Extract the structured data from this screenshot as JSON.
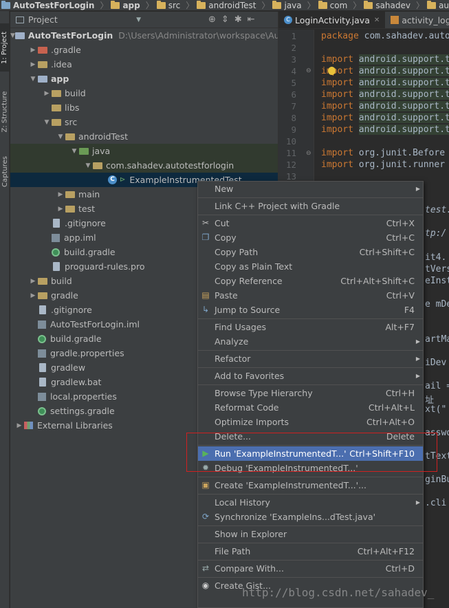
{
  "breadcrumb": [
    "AutoTestForLogin",
    "app",
    "src",
    "androidTest",
    "java",
    "com",
    "sahadev",
    "autotestforlogin"
  ],
  "toolstrip": {
    "project": "1: Project",
    "structure": "Z: Structure",
    "captures": "Captures"
  },
  "project_panel": {
    "title": "Project"
  },
  "tree": [
    {
      "label": "AutoTestForLogin",
      "path": "D:\\Users\\Administrator\\workspace\\AutoTestForLogin",
      "icon": "module-icon"
    },
    {
      "label": ".gradle",
      "icon": "folder-icon"
    },
    {
      "label": ".idea",
      "icon": "folder-icon"
    },
    {
      "label": "app",
      "icon": "module-folder-icon"
    },
    {
      "label": "build",
      "icon": "folder-icon"
    },
    {
      "label": "libs",
      "icon": "folder-icon"
    },
    {
      "label": "src",
      "icon": "folder-icon"
    },
    {
      "label": "androidTest",
      "icon": "folder-icon"
    },
    {
      "label": "java",
      "icon": "test-source-folder-icon"
    },
    {
      "label": "com.sahadev.autotestforlogin",
      "icon": "package-icon"
    },
    {
      "label": "ExampleInstrumentedTest",
      "icon": "class-icon"
    },
    {
      "label": "main",
      "icon": "folder-icon"
    },
    {
      "label": "test",
      "icon": "folder-icon"
    },
    {
      "label": ".gitignore",
      "icon": "file-icon"
    },
    {
      "label": "app.iml",
      "icon": "iml-file-icon"
    },
    {
      "label": "build.gradle",
      "icon": "gradle-icon"
    },
    {
      "label": "proguard-rules.pro",
      "icon": "file-icon"
    },
    {
      "label": "build",
      "icon": "folder-icon"
    },
    {
      "label": "gradle",
      "icon": "folder-icon"
    },
    {
      "label": ".gitignore",
      "icon": "file-icon"
    },
    {
      "label": "AutoTestForLogin.iml",
      "icon": "iml-file-icon"
    },
    {
      "label": "build.gradle",
      "icon": "gradle-icon"
    },
    {
      "label": "gradle.properties",
      "icon": "properties-file-icon"
    },
    {
      "label": "gradlew",
      "icon": "file-icon"
    },
    {
      "label": "gradlew.bat",
      "icon": "file-icon"
    },
    {
      "label": "local.properties",
      "icon": "properties-file-icon"
    },
    {
      "label": "settings.gradle",
      "icon": "gradle-icon"
    },
    {
      "label": "External Libraries",
      "icon": "libraries-icon"
    }
  ],
  "editor": {
    "tabs": [
      {
        "label": "LoginActivity.java"
      },
      {
        "label": "activity_login"
      }
    ],
    "line_numbers": [
      "1",
      "2",
      "3",
      "4",
      "5",
      "6",
      "7",
      "8",
      "9",
      "10",
      "11",
      "12",
      "13"
    ],
    "lines": {
      "l1": {
        "kw": "package",
        "rest": " com.sahadev.auto"
      },
      "l3": {
        "kw": "import",
        "rest": "android.support.t"
      },
      "l4": {
        "kw": "import",
        "rest": "android.support.t"
      },
      "l5": {
        "kw": "import",
        "rest": "android.support.t"
      },
      "l6": {
        "kw": "import",
        "rest": "android.support.t"
      },
      "l7": {
        "kw": "import",
        "rest": "android.support.t"
      },
      "l8": {
        "kw": "import",
        "rest": "android.support.t"
      },
      "l9": {
        "kw": "import",
        "rest": "android.support.t"
      },
      "l11": {
        "kw": "import",
        "rest": "org.junit.Before"
      },
      "l12": {
        "kw": "import",
        "rest": "org.junit.runner"
      }
    },
    "fragments": [
      "test.",
      "tp:/",
      "it4.",
      "tVers",
      "eInst",
      "e mDe",
      "artMa",
      "iDev",
      "ail =",
      "址",
      "xt(\"",
      "asswo",
      "tText",
      "ginBu",
      ".cli"
    ]
  },
  "context_menu": {
    "items": [
      {
        "label": "New",
        "shortcut": "",
        "submenu": true
      },
      {
        "label": "Link C++ Project with Gradle",
        "shortcut": ""
      },
      {
        "label": "Cut",
        "shortcut": "Ctrl+X"
      },
      {
        "label": "Copy",
        "shortcut": "Ctrl+C"
      },
      {
        "label": "Copy Path",
        "shortcut": "Ctrl+Shift+C"
      },
      {
        "label": "Copy as Plain Text",
        "shortcut": ""
      },
      {
        "label": "Copy Reference",
        "shortcut": "Ctrl+Alt+Shift+C"
      },
      {
        "label": "Paste",
        "shortcut": "Ctrl+V"
      },
      {
        "label": "Jump to Source",
        "shortcut": "F4"
      },
      {
        "label": "Find Usages",
        "shortcut": "Alt+F7"
      },
      {
        "label": "Analyze",
        "shortcut": "",
        "submenu": true
      },
      {
        "label": "Refactor",
        "shortcut": "",
        "submenu": true
      },
      {
        "label": "Add to Favorites",
        "shortcut": "",
        "submenu": true
      },
      {
        "label": "Browse Type Hierarchy",
        "shortcut": "Ctrl+H"
      },
      {
        "label": "Reformat Code",
        "shortcut": "Ctrl+Alt+L"
      },
      {
        "label": "Optimize Imports",
        "shortcut": "Ctrl+Alt+O"
      },
      {
        "label": "Delete...",
        "shortcut": "Delete"
      },
      {
        "label": "Run 'ExampleInstrumentedT...'",
        "shortcut": "Ctrl+Shift+F10"
      },
      {
        "label": "Debug 'ExampleInstrumentedT...'",
        "shortcut": ""
      },
      {
        "label": "Create 'ExampleInstrumentedT...'...",
        "shortcut": ""
      },
      {
        "label": "Local History",
        "shortcut": "",
        "submenu": true
      },
      {
        "label": "Synchronize 'ExampleIns...dTest.java'",
        "shortcut": ""
      },
      {
        "label": "Show in Explorer",
        "shortcut": ""
      },
      {
        "label": "File Path",
        "shortcut": "Ctrl+Alt+F12"
      },
      {
        "label": "Compare With...",
        "shortcut": "Ctrl+D"
      },
      {
        "label": "Create Gist...",
        "shortcut": ""
      }
    ]
  },
  "watermark": "http://blog.csdn.net/sahadev_",
  "colors": {
    "menu_highlight": "#4b6eaf",
    "annotation_box": "#d02020",
    "keyword": "#cc7832"
  }
}
